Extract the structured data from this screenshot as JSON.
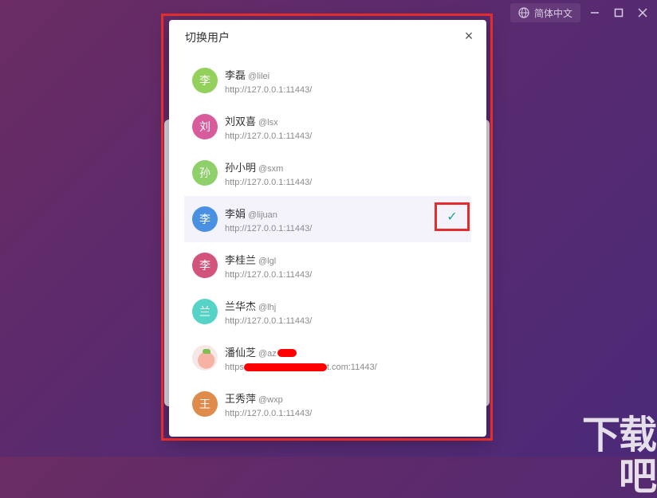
{
  "header": {
    "language_label": "简体中文",
    "icons": {
      "language": "globe-icon",
      "minimize": "minimize-icon",
      "maximize": "maximize-icon",
      "close": "close-icon"
    }
  },
  "dialog": {
    "title": "切换用户",
    "close_label": "×"
  },
  "users": [
    {
      "avatar_char": "李",
      "color": "#93d15c",
      "name": "李磊",
      "handle": "@lilei",
      "url": "http://127.0.0.1:11443/"
    },
    {
      "avatar_char": "刘",
      "color": "#d85c9c",
      "name": "刘双喜",
      "handle": "@lsx",
      "url": "http://127.0.0.1:11443/"
    },
    {
      "avatar_char": "孙",
      "color": "#8fd06a",
      "name": "孙小明",
      "handle": "@sxm",
      "url": "http://127.0.0.1:11443/"
    },
    {
      "avatar_char": "李",
      "color": "#4a90e2",
      "name": "李娟",
      "handle": "@lijuan",
      "url": "http://127.0.0.1:11443/",
      "selected": true
    },
    {
      "avatar_char": "李",
      "color": "#d2547d",
      "name": "李桂兰",
      "handle": "@lgl",
      "url": "http://127.0.0.1:11443/"
    },
    {
      "avatar_char": "兰",
      "color": "#55d3c6",
      "name": "兰华杰",
      "handle": "@lhj",
      "url": "http://127.0.0.1:11443/"
    },
    {
      "avatar_char": "",
      "color": "",
      "name": "潘仙芝",
      "handle": "@az",
      "url_prefix": "https",
      "url_suffix": "t.com:11443/",
      "image_avatar": true
    },
    {
      "avatar_char": "王",
      "color": "#de8b4c",
      "name": "王秀萍",
      "handle": "@wxp",
      "url": "http://127.0.0.1:11443/"
    }
  ],
  "check_mark": "✓",
  "watermark": "下载吧"
}
